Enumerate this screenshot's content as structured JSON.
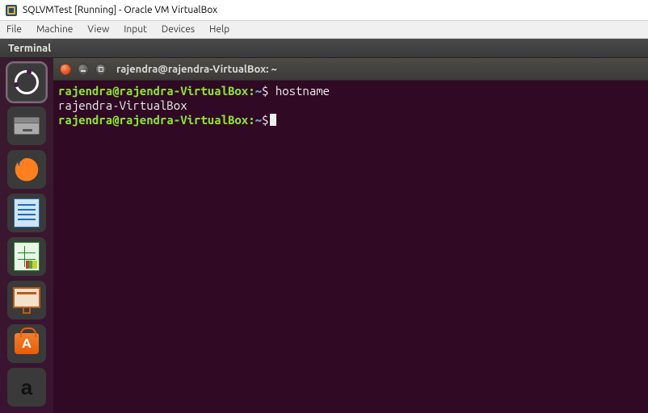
{
  "host": {
    "title": "SQLVMTest [Running] - Oracle VM VirtualBox",
    "menu": {
      "file": "File",
      "machine": "Machine",
      "view": "View",
      "input": "Input",
      "devices": "Devices",
      "help": "Help"
    }
  },
  "guest": {
    "panel_title": "Terminal",
    "launcher": [
      {
        "name": "dash",
        "tip": "Search your computer"
      },
      {
        "name": "files",
        "tip": "Files"
      },
      {
        "name": "firefox",
        "tip": "Firefox Web Browser"
      },
      {
        "name": "writer",
        "tip": "LibreOffice Writer"
      },
      {
        "name": "calc",
        "tip": "LibreOffice Calc"
      },
      {
        "name": "impress",
        "tip": "LibreOffice Impress"
      },
      {
        "name": "software",
        "tip": "Ubuntu Software"
      },
      {
        "name": "amazon",
        "tip": "Amazon"
      }
    ]
  },
  "terminal": {
    "title": "rajendra@rajendra-VirtualBox: ~",
    "prompt_user_host": "rajendra@rajendra-VirtualBox",
    "prompt_path": "~",
    "prompt_symbol": "$",
    "lines": {
      "cmd1": "hostname",
      "out1": "rajendra-VirtualBox"
    }
  }
}
